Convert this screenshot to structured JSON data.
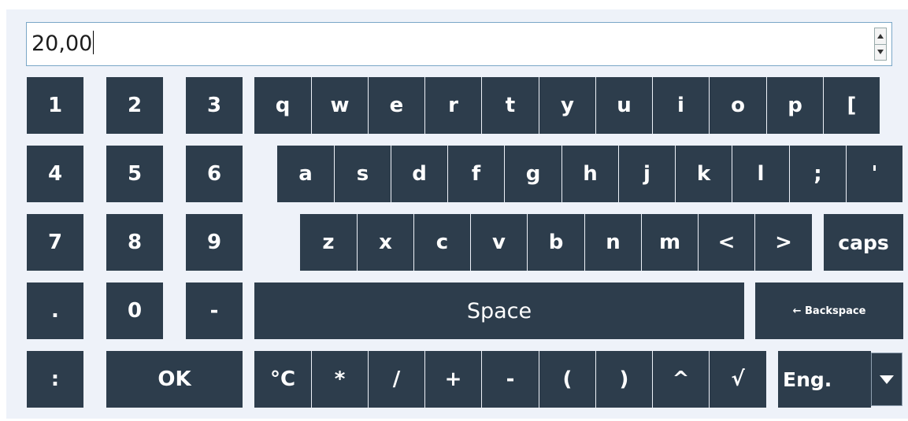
{
  "input": {
    "value": "20,00"
  },
  "numpad": [
    [
      "1",
      "2",
      "3"
    ],
    [
      "4",
      "5",
      "6"
    ],
    [
      "7",
      "8",
      "9"
    ],
    [
      ".",
      "0",
      "-"
    ]
  ],
  "row1": [
    "q",
    "w",
    "e",
    "r",
    "t",
    "y",
    "u",
    "i",
    "o",
    "p",
    "["
  ],
  "row2": [
    "a",
    "s",
    "d",
    "f",
    "g",
    "h",
    "j",
    "k",
    "l",
    ";",
    "'"
  ],
  "row3": [
    "z",
    "x",
    "c",
    "v",
    "b",
    "n",
    "m",
    "<",
    ">"
  ],
  "caps_label": "caps",
  "space_label": "Space",
  "backspace_label": "← Backspace",
  "colon_label": ":",
  "ok_label": "OK",
  "symbols": [
    "°C",
    "*",
    "/",
    "+",
    "-",
    "(",
    ")",
    "^",
    "√"
  ],
  "language": {
    "selected": "Eng."
  },
  "colors": {
    "key_bg": "#2d3d4c",
    "key_text": "#ffffff",
    "panel_bg": "#eef2f9",
    "input_border": "#7aa7c7"
  },
  "icons": {
    "spin_up": "triangle-up-icon",
    "spin_down": "triangle-down-icon",
    "dropdown": "chevron-down-icon"
  }
}
